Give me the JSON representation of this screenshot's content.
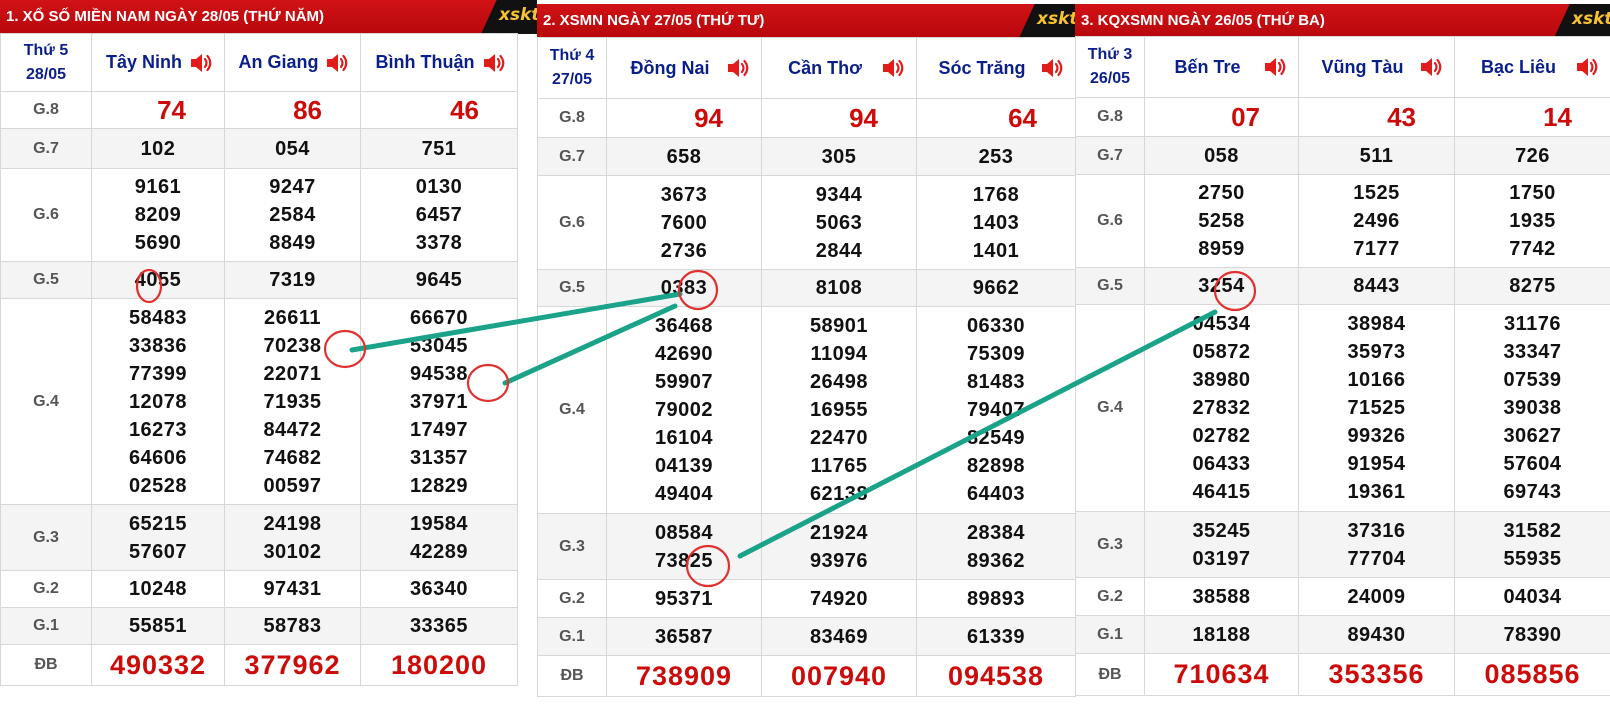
{
  "brand": "xskt",
  "panels": [
    {
      "title": "1. XỔ SỐ MIỀN NAM NGÀY 28/05 (THỨ NĂM)",
      "day": "Thứ 5",
      "date": "28/05",
      "provinces": [
        "Tây Ninh",
        "An Giang",
        "Bình Thuận"
      ],
      "rows": [
        {
          "label": "G.8",
          "values": [
            [
              "74"
            ],
            [
              "86"
            ],
            [
              "46"
            ]
          ]
        },
        {
          "label": "G.7",
          "values": [
            [
              "102"
            ],
            [
              "054"
            ],
            [
              "751"
            ]
          ]
        },
        {
          "label": "G.6",
          "values": [
            [
              "9161",
              "8209",
              "5690"
            ],
            [
              "9247",
              "2584",
              "8849"
            ],
            [
              "0130",
              "6457",
              "3378"
            ]
          ]
        },
        {
          "label": "G.5",
          "values": [
            [
              "4055"
            ],
            [
              "7319"
            ],
            [
              "9645"
            ]
          ]
        },
        {
          "label": "G.4",
          "values": [
            [
              "58483",
              "33836",
              "77399",
              "12078",
              "16273",
              "64606",
              "02528"
            ],
            [
              "26611",
              "70238",
              "22071",
              "71935",
              "84472",
              "74682",
              "00597"
            ],
            [
              "66670",
              "53045",
              "94538",
              "37971",
              "17497",
              "31357",
              "12829"
            ]
          ]
        },
        {
          "label": "G.3",
          "values": [
            [
              "65215",
              "57607"
            ],
            [
              "24198",
              "30102"
            ],
            [
              "19584",
              "42289"
            ]
          ]
        },
        {
          "label": "G.2",
          "values": [
            [
              "10248"
            ],
            [
              "97431"
            ],
            [
              "36340"
            ]
          ]
        },
        {
          "label": "G.1",
          "values": [
            [
              "55851"
            ],
            [
              "58783"
            ],
            [
              "33365"
            ]
          ]
        },
        {
          "label": "ĐB",
          "values": [
            [
              "490332"
            ],
            [
              "377962"
            ],
            [
              "180200"
            ]
          ]
        }
      ]
    },
    {
      "title": "2. XSMN NGÀY 27/05 (THỨ TƯ)",
      "day": "Thứ 4",
      "date": "27/05",
      "provinces": [
        "Đồng Nai",
        "Cần Thơ",
        "Sóc Trăng"
      ],
      "rows": [
        {
          "label": "G.8",
          "values": [
            [
              "94"
            ],
            [
              "94"
            ],
            [
              "64"
            ]
          ]
        },
        {
          "label": "G.7",
          "values": [
            [
              "658"
            ],
            [
              "305"
            ],
            [
              "253"
            ]
          ]
        },
        {
          "label": "G.6",
          "values": [
            [
              "3673",
              "7600",
              "2736"
            ],
            [
              "9344",
              "5063",
              "2844"
            ],
            [
              "1768",
              "1403",
              "1401"
            ]
          ]
        },
        {
          "label": "G.5",
          "values": [
            [
              "0383"
            ],
            [
              "8108"
            ],
            [
              "9662"
            ]
          ]
        },
        {
          "label": "G.4",
          "values": [
            [
              "36468",
              "42690",
              "59907",
              "79002",
              "16104",
              "04139",
              "49404"
            ],
            [
              "58901",
              "11094",
              "26498",
              "16955",
              "22470",
              "11765",
              "62138"
            ],
            [
              "06330",
              "75309",
              "81483",
              "79407",
              "82549",
              "82898",
              "64403"
            ]
          ]
        },
        {
          "label": "G.3",
          "values": [
            [
              "08584",
              "73825"
            ],
            [
              "21924",
              "93976"
            ],
            [
              "28384",
              "89362"
            ]
          ]
        },
        {
          "label": "G.2",
          "values": [
            [
              "95371"
            ],
            [
              "74920"
            ],
            [
              "89893"
            ]
          ]
        },
        {
          "label": "G.1",
          "values": [
            [
              "36587"
            ],
            [
              "83469"
            ],
            [
              "61339"
            ]
          ]
        },
        {
          "label": "ĐB",
          "values": [
            [
              "738909"
            ],
            [
              "007940"
            ],
            [
              "094538"
            ]
          ]
        }
      ]
    },
    {
      "title": "3. KQXSMN NGÀY 26/05 (THỨ BA)",
      "day": "Thứ 3",
      "date": "26/05",
      "provinces": [
        "Bến Tre",
        "Vũng Tàu",
        "Bạc Liêu"
      ],
      "rows": [
        {
          "label": "G.8",
          "values": [
            [
              "07"
            ],
            [
              "43"
            ],
            [
              "14"
            ]
          ]
        },
        {
          "label": "G.7",
          "values": [
            [
              "058"
            ],
            [
              "511"
            ],
            [
              "726"
            ]
          ]
        },
        {
          "label": "G.6",
          "values": [
            [
              "2750",
              "5258",
              "8959"
            ],
            [
              "1525",
              "2496",
              "7177"
            ],
            [
              "1750",
              "1935",
              "7742"
            ]
          ]
        },
        {
          "label": "G.5",
          "values": [
            [
              "3254"
            ],
            [
              "8443"
            ],
            [
              "8275"
            ]
          ]
        },
        {
          "label": "G.4",
          "values": [
            [
              "04534",
              "05872",
              "38980",
              "27832",
              "02782",
              "06433",
              "46415"
            ],
            [
              "38984",
              "35973",
              "10166",
              "71525",
              "99326",
              "91954",
              "19361"
            ],
            [
              "31176",
              "33347",
              "07539",
              "39038",
              "30627",
              "57604",
              "69743"
            ]
          ]
        },
        {
          "label": "G.3",
          "values": [
            [
              "35245",
              "03197"
            ],
            [
              "37316",
              "77704"
            ],
            [
              "31582",
              "55935"
            ]
          ]
        },
        {
          "label": "G.2",
          "values": [
            [
              "38588"
            ],
            [
              "24009"
            ],
            [
              "04034"
            ]
          ]
        },
        {
          "label": "G.1",
          "values": [
            [
              "18188"
            ],
            [
              "89430"
            ],
            [
              "78390"
            ]
          ]
        },
        {
          "label": "ĐB",
          "values": [
            [
              "710634"
            ],
            [
              "353356"
            ],
            [
              "085856"
            ]
          ]
        }
      ]
    }
  ],
  "colors": {
    "title_bar": "#c80d11",
    "province_text": "#0b1f8a",
    "special_red": "#cc0b0b",
    "circle_red": "#e03030",
    "line_teal": "#1aa388"
  }
}
